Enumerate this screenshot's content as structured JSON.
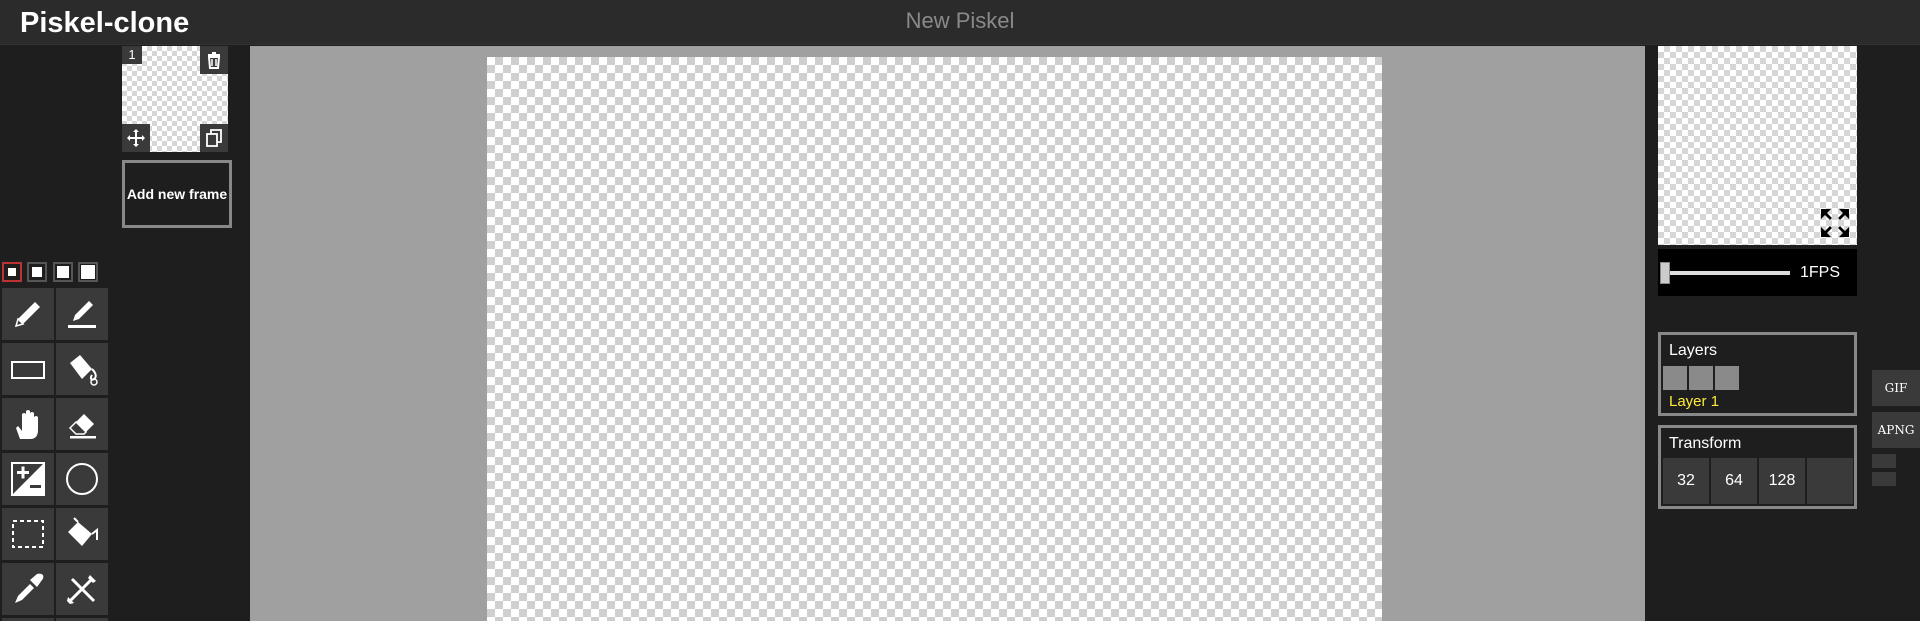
{
  "header": {
    "app_title": "Piskel-clone",
    "document_title": "New Piskel"
  },
  "frames": {
    "items": [
      {
        "number": "1"
      }
    ],
    "add_label": "Add new frame"
  },
  "tools": {
    "pen_sizes": [
      1,
      2,
      3,
      4
    ],
    "selected_pen_size": 1,
    "items": [
      {
        "name": "pen-tool",
        "icon": "pencil-icon"
      },
      {
        "name": "stroke-tool",
        "icon": "stroke-icon"
      },
      {
        "name": "rectangle-tool",
        "icon": "rectangle-icon"
      },
      {
        "name": "paint-bucket-tool",
        "icon": "paint-bucket-icon"
      },
      {
        "name": "move-tool",
        "icon": "hand-icon"
      },
      {
        "name": "eraser-tool",
        "icon": "eraser-icon"
      },
      {
        "name": "lighten-tool",
        "icon": "plus-minus-icon"
      },
      {
        "name": "circle-tool",
        "icon": "circle-icon"
      },
      {
        "name": "rectangle-select-tool",
        "icon": "dashed-rect-icon"
      },
      {
        "name": "color-swap-tool",
        "icon": "bucket-swap-icon"
      },
      {
        "name": "color-picker-tool",
        "icon": "eyedropper-icon"
      },
      {
        "name": "dithering-tool",
        "icon": "crossed-tools-icon"
      }
    ]
  },
  "preview": {
    "fps_label": "1FPS",
    "fps_value": 1
  },
  "layers": {
    "title": "Layers",
    "items": [
      {
        "name": "Layer 1"
      }
    ]
  },
  "transform": {
    "title": "Transform",
    "sizes": [
      "32",
      "64",
      "128"
    ]
  },
  "export": {
    "gif_label": "GIF",
    "apng_label": "APNG"
  },
  "colors": {
    "active_layer": "#ffeb3b",
    "selected_pen_border": "#b33333"
  }
}
